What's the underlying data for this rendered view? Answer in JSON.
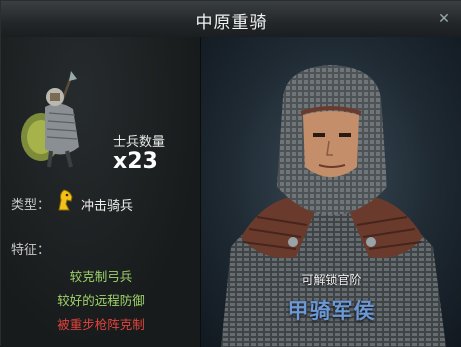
{
  "window": {
    "title": "中原重骑"
  },
  "unit": {
    "count_label": "士兵数量",
    "count": "x23",
    "type_label": "类型：",
    "type_value": "冲击骑兵",
    "type_icon": "horse-head-icon",
    "features_label": "特征："
  },
  "traits": [
    {
      "text": "较克制弓兵",
      "kind": "advantage"
    },
    {
      "text": "较好的远程防御",
      "kind": "advantage"
    },
    {
      "text": "被重步枪阵克制",
      "kind": "weakness"
    }
  ],
  "general": {
    "unlock_label": "可解锁官阶",
    "rank": "甲骑军侯"
  },
  "colors": {
    "advantage": "#9fd36a",
    "weakness": "#e3433b",
    "rank": "#6c98d6"
  }
}
